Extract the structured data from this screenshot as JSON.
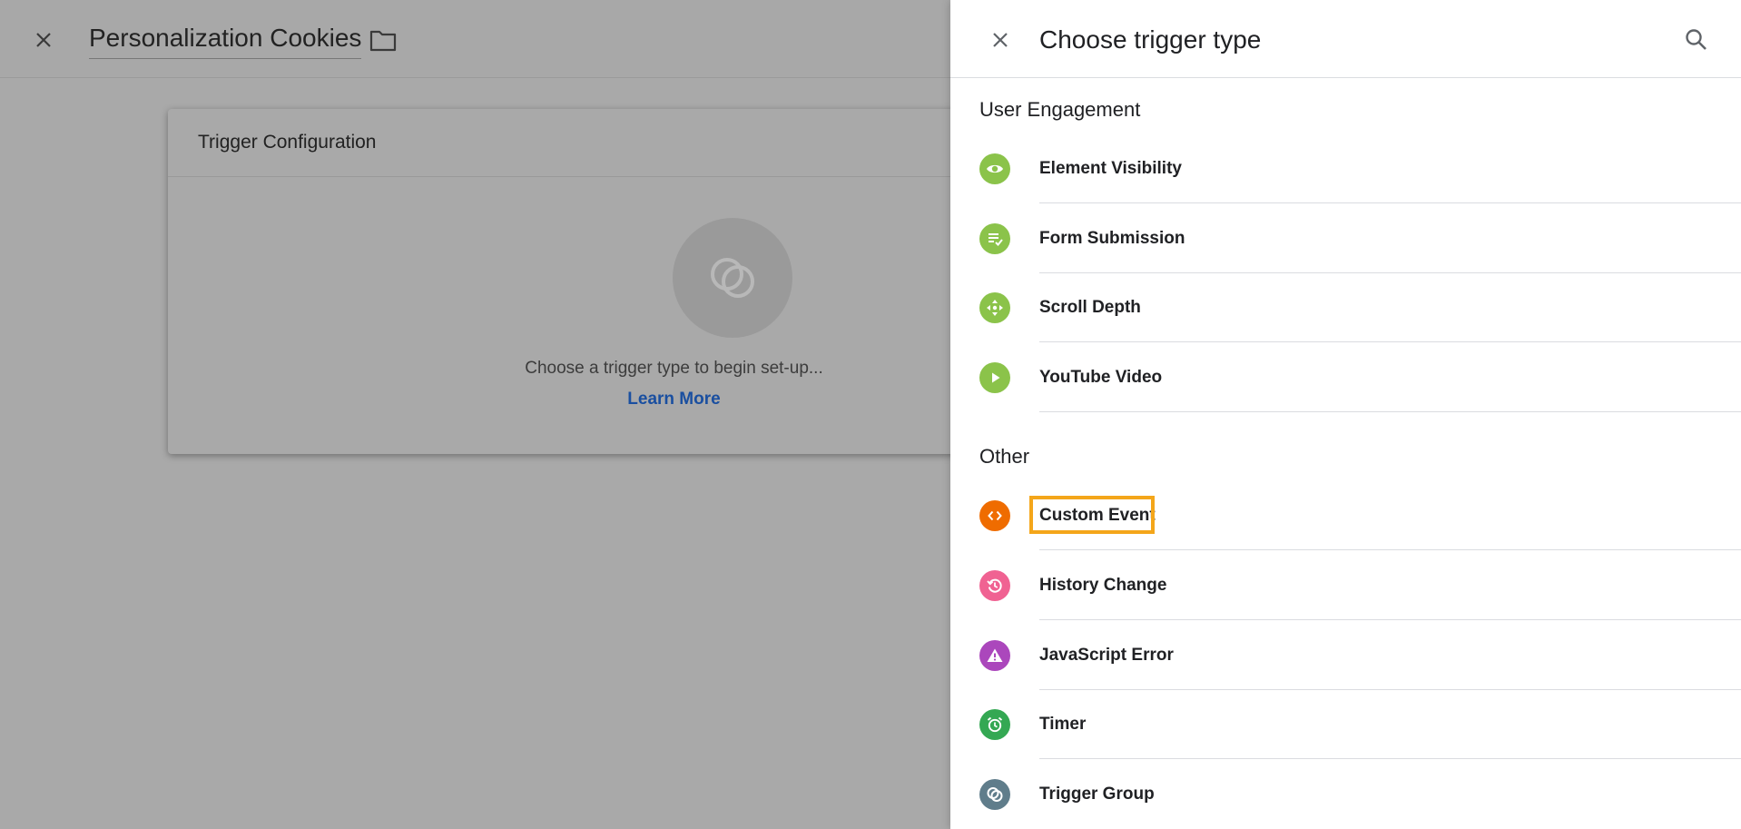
{
  "editor": {
    "title": "Personalization Cookies",
    "card_title": "Trigger Configuration",
    "empty_text": "Choose a trigger type to begin set-up...",
    "learn_more": "Learn More"
  },
  "panel": {
    "title": "Choose trigger type",
    "sections": [
      {
        "title": "User Engagement",
        "items": [
          {
            "label": "Element Visibility",
            "icon": "eye-icon",
            "color": "#8bc34a"
          },
          {
            "label": "Form Submission",
            "icon": "form-check-icon",
            "color": "#8bc34a"
          },
          {
            "label": "Scroll Depth",
            "icon": "scroll-arrows-icon",
            "color": "#8bc34a"
          },
          {
            "label": "YouTube Video",
            "icon": "play-icon",
            "color": "#8bc34a"
          }
        ]
      },
      {
        "title": "Other",
        "items": [
          {
            "label": "Custom Event",
            "icon": "code-icon",
            "color": "#ef6c00"
          },
          {
            "label": "History Change",
            "icon": "history-icon",
            "color": "#f06292"
          },
          {
            "label": "JavaScript Error",
            "icon": "warning-icon",
            "color": "#ab47bc"
          },
          {
            "label": "Timer",
            "icon": "alarm-icon",
            "color": "#34a853"
          },
          {
            "label": "Trigger Group",
            "icon": "trigger-group-icon",
            "color": "#607d8b"
          }
        ]
      }
    ]
  },
  "highlight_color": "#f4a61a"
}
